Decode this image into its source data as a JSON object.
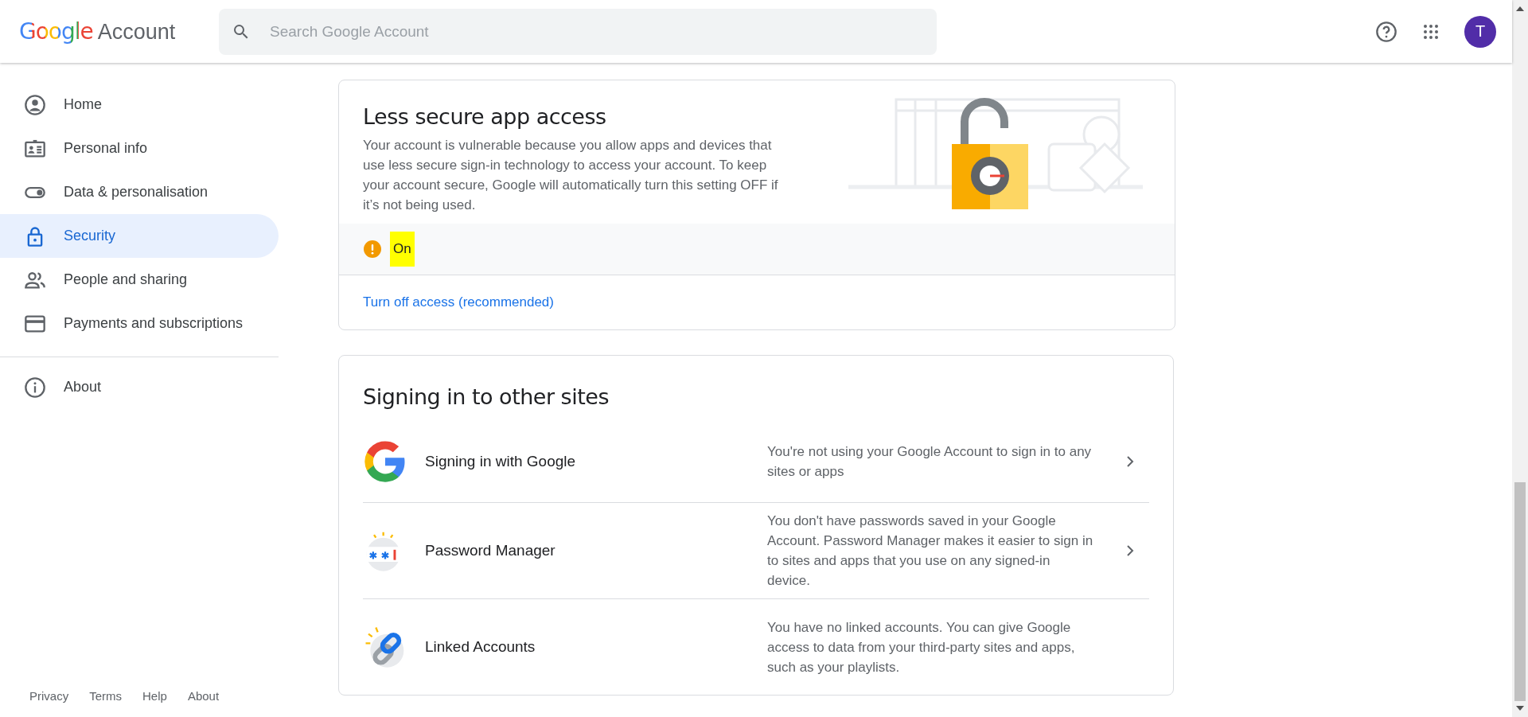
{
  "header": {
    "logo_brand": "Google",
    "logo_product": "Account",
    "search": {
      "placeholder": "Search Google Account"
    },
    "avatar_letter": "T"
  },
  "sidebar": {
    "items": [
      {
        "label": "Home",
        "selected": false
      },
      {
        "label": "Personal info",
        "selected": false
      },
      {
        "label": "Data & personalisation",
        "selected": false
      },
      {
        "label": "Security",
        "selected": true
      },
      {
        "label": "People and sharing",
        "selected": false
      },
      {
        "label": "Payments and subscriptions",
        "selected": false
      }
    ],
    "secondary_items": [
      {
        "label": "About",
        "selected": false
      }
    ],
    "footer_links": [
      "Privacy",
      "Terms",
      "Help",
      "About"
    ]
  },
  "less_secure_card": {
    "title": "Less secure app access",
    "description": "Your account is vulnerable because you allow apps and devices that use less secure sign-in technology to access your account. To keep your account secure, Google will automatically turn this setting OFF if it’s not being used.",
    "status": {
      "kind": "warning",
      "label": "On",
      "highlighted": true
    },
    "action": "Turn off access (recommended)"
  },
  "signing_card": {
    "title": "Signing in to other sites",
    "rows": [
      {
        "kind": "google",
        "label": "Signing in with Google",
        "description": "You're not using your Google Account to sign in to any sites or apps",
        "has_chevron": true
      },
      {
        "kind": "password",
        "label": "Password Manager",
        "description": "You don't have passwords saved in your Google Account. Password Manager makes it easier to sign in to sites and apps that you use on any signed-in device.",
        "has_chevron": true
      },
      {
        "kind": "linked",
        "label": "Linked Accounts",
        "description": "You have no linked accounts. You can give Google access to data from your third-party sites and apps, such as your playlists.",
        "has_chevron": false
      }
    ]
  }
}
